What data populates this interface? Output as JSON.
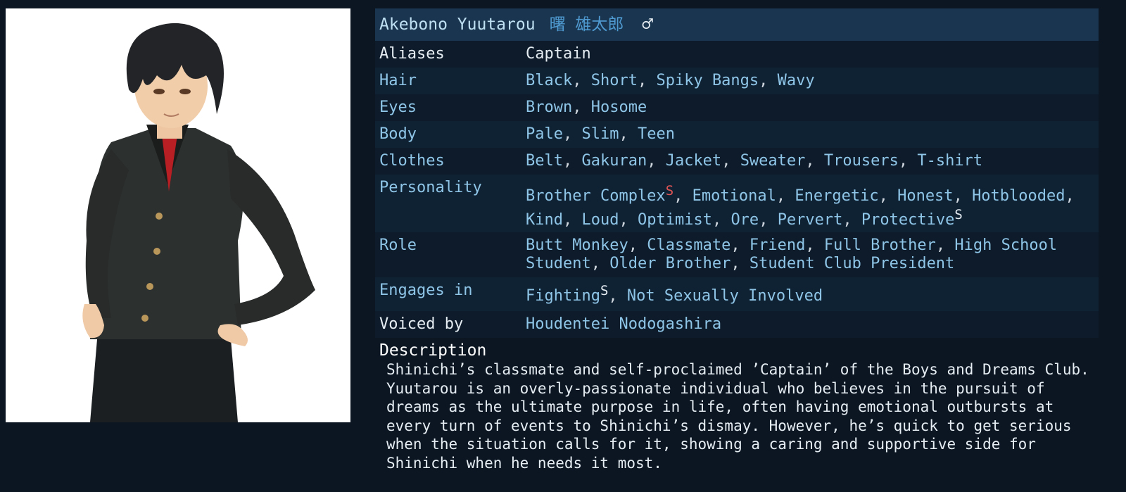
{
  "character": {
    "name_en": "Akebono Yuutarou",
    "name_jp": "曙 雄太郎",
    "gender_symbol": "♂"
  },
  "rows": {
    "aliases": {
      "label": "Aliases",
      "value": "Captain"
    },
    "hair": {
      "label": "Hair",
      "values": [
        "Black",
        "Short",
        "Spiky Bangs",
        "Wavy"
      ]
    },
    "eyes": {
      "label": "Eyes",
      "values": [
        "Brown",
        "Hosome"
      ]
    },
    "body": {
      "label": "Body",
      "values": [
        "Pale",
        "Slim",
        "Teen"
      ]
    },
    "clothes": {
      "label": "Clothes",
      "values": [
        "Belt",
        "Gakuran",
        "Jacket",
        "Sweater",
        "Trousers",
        "T-shirt"
      ]
    },
    "personality": {
      "label": "Personality",
      "values": [
        "Brother Complex",
        "Emotional",
        "Energetic",
        "Honest",
        "Hotblooded",
        "Kind",
        "Loud",
        "Optimist",
        "Ore",
        "Pervert",
        "Protective"
      ]
    },
    "role": {
      "label": "Role",
      "values": [
        "Butt Monkey",
        "Classmate",
        "Friend",
        "Full Brother",
        "High School Student",
        "Older Brother",
        "Student Club President"
      ]
    },
    "engages": {
      "label": "Engages in",
      "values": [
        "Fighting",
        "Not Sexually Involved"
      ]
    },
    "voiced": {
      "label": "Voiced by",
      "value": "Houdentei Nodogashira"
    }
  },
  "spoiler_marker": "S",
  "separator": ",",
  "description": {
    "title": "Description",
    "text": "Shinichi’s classmate and self-proclaimed ’Captain’ of the Boys and Dreams Club. Yuutarou is an overly-passionate individual who believes in the pursuit of dreams as the ultimate purpose in life, often having emotional outbursts at every turn of events to Shinichi’s dismay. However, he’s quick to get serious when the situation calls for it, showing a caring and supportive side for Shinichi when he needs it most."
  },
  "colors": {
    "page_bg": "#0b1622",
    "title_bg": "#1a3550",
    "link": "#8fc6e8",
    "jp_name": "#4f9ad0",
    "spoiler_major": "#e05555"
  }
}
